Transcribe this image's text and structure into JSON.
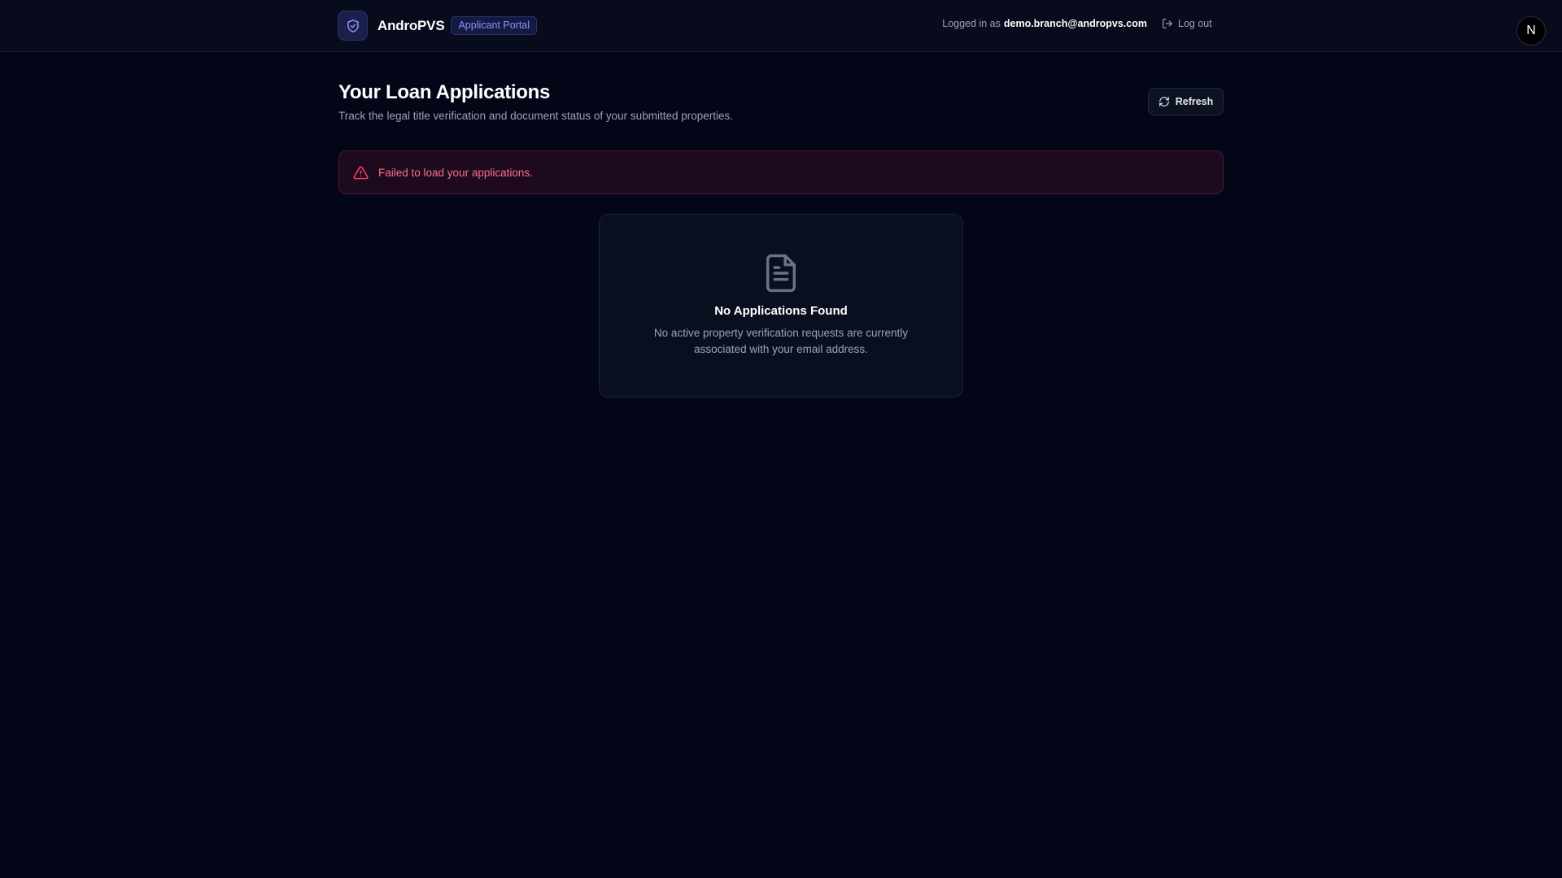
{
  "header": {
    "brand_name": "AndroPVS",
    "portal_badge": "Applicant Portal",
    "logged_in_prefix": "Logged in as",
    "user_email": "demo.branch@andropvs.com",
    "logout_label": "Log out",
    "avatar_initial": "N",
    "logo_icon": "shield-check-icon"
  },
  "page": {
    "title": "Your Loan Applications",
    "subtitle": "Track the legal title verification and document status of your submitted properties.",
    "refresh_label": "Refresh"
  },
  "error": {
    "message": "Failed to load your applications.",
    "icon": "warning-triangle-icon"
  },
  "empty_state": {
    "icon": "document-icon",
    "title": "No Applications Found",
    "description": "No active property verification requests are currently associated with your email address."
  },
  "colors": {
    "background": "#030616",
    "header": "#070b1b",
    "accent": "#6b73ff",
    "error": "#f43f5e",
    "card": "#0a0f20"
  }
}
